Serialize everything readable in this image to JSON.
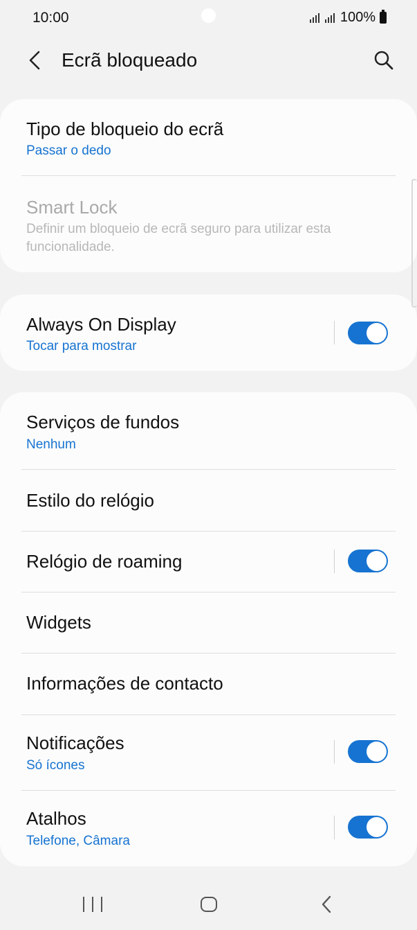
{
  "status": {
    "time": "10:00",
    "battery": "100%"
  },
  "header": {
    "title": "Ecrã bloqueado"
  },
  "lock_card": {
    "type_label": "Tipo de bloqueio do ecrã",
    "type_value": "Passar o dedo",
    "smart_lock_label": "Smart Lock",
    "smart_lock_desc": "Definir um bloqueio de ecrã seguro para utilizar esta funcionalidade."
  },
  "aod_card": {
    "label": "Always On Display",
    "sub": "Tocar para mostrar",
    "enabled": true
  },
  "settings": {
    "wallpaper_label": "Serviços de fundos",
    "wallpaper_value": "Nenhum",
    "clock_style_label": "Estilo do relógio",
    "roaming_clock_label": "Relógio de roaming",
    "roaming_clock_enabled": true,
    "widgets_label": "Widgets",
    "contact_info_label": "Informações de contacto",
    "notifications_label": "Notificações",
    "notifications_value": "Só ícones",
    "notifications_enabled": true,
    "shortcuts_label": "Atalhos",
    "shortcuts_value": "Telefone, Câmara",
    "shortcuts_enabled": true
  },
  "icons": {
    "back": "back-arrow-icon",
    "search": "search-icon",
    "nav_recents": "recents-icon",
    "nav_home": "home-icon",
    "nav_back": "nav-back-icon"
  },
  "colors": {
    "accent": "#1673d1",
    "background": "#f2f2f2",
    "card": "#fcfcfc"
  }
}
